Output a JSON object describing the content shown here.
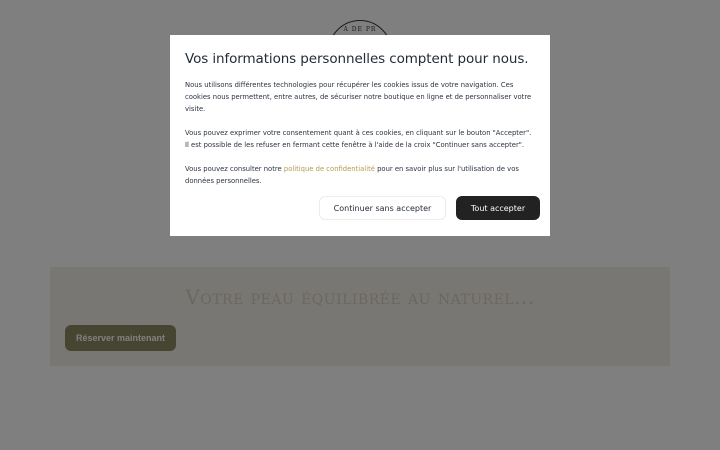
{
  "background": {
    "logo": {
      "text": "A DE PR"
    },
    "hero": {
      "title": "Votre peau équilibrée au naturel...",
      "button_label": "Réserver maintenant"
    }
  },
  "cookie_modal": {
    "title": "Vos informations personnelles comptent pour nous.",
    "paragraph_1": "Nous utilisons différentes technologies pour récupérer les cookies issus de votre navigation. Ces cookies nous permettent, entre autres, de sécuriser notre boutique en ligne et de personnaliser votre visite.",
    "paragraph_2": "Vous pouvez exprimer votre consentement quant à ces cookies, en cliquant sur le bouton \"Accepter\". Il est possible de les refuser en fermant cette fenêtre à l'aide de la croix \"Continuer sans accepter\".",
    "paragraph_3_before": "Vous pouvez consulter notre ",
    "paragraph_3_link": "politique de confidentialité",
    "paragraph_3_after": " pour en savoir plus sur l'utilisation de vos données personnelles.",
    "continue_label": "Continuer sans accepter",
    "accept_label": "Tout accepter"
  },
  "colors": {
    "overlay": "#000000",
    "hero_background": "#f3efe6",
    "hero_button": "#8a8a63",
    "link": "#b39b54",
    "accept_button": "#222222"
  }
}
